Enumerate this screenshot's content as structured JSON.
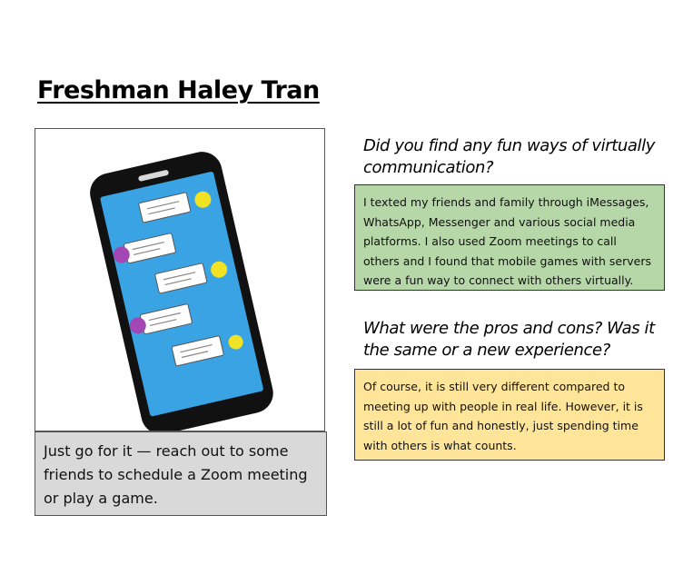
{
  "title": "Freshman Haley Tran",
  "illustration": {
    "name": "smartphone-with-message-bubbles",
    "colors": {
      "body": "#111111",
      "screen": "#3aa3e3",
      "bubble": "#ffffff",
      "dot_yellow": "#f2e224",
      "dot_purple": "#a347b5"
    }
  },
  "caption": "Just go for it — reach out to some friends to schedule a Zoom meeting or play a game.",
  "qa": [
    {
      "question": "Did you find any fun ways of virtually communication?",
      "answer": "I texted my friends and family through iMessages, WhatsApp, Messenger and various social media platforms. I also used Zoom meetings to call others and I found that mobile games with servers were a fun way to connect with others virtually.",
      "color": "#b6d7a8"
    },
    {
      "question": "What were the pros and cons? Was it the same or a new experience?",
      "answer": "Of course, it is still very different compared to meeting up with people in real life. However, it is still a lot of fun and honestly, just spending time with others is what counts.",
      "color": "#ffe599"
    }
  ]
}
